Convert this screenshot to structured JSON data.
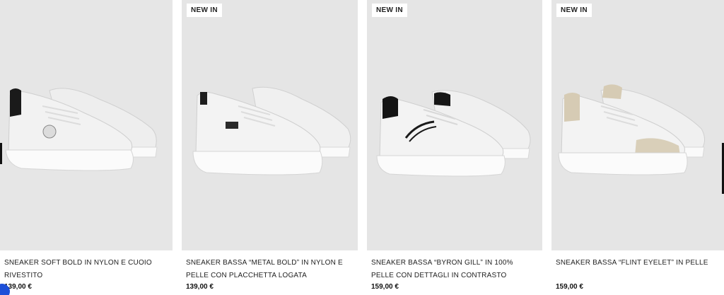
{
  "products": [
    {
      "badge": "",
      "name": "SNEAKER SOFT BOLD IN NYLON E CUOIO RIVESTITO",
      "price": "139,00 €",
      "accent": "#1a1a1a"
    },
    {
      "badge": "NEW IN",
      "name": "SNEAKER BASSA “METAL BOLD” IN NYLON E PELLE CON PLACCHETTA LOGATA",
      "price": "139,00 €",
      "accent": "#2a2a2a"
    },
    {
      "badge": "NEW IN",
      "name": "SNEAKER BASSA “BYRON GILL” IN 100% PELLE CON DETTAGLI IN CONTRASTO",
      "price": "159,00 €",
      "accent": "#111111"
    },
    {
      "badge": "NEW IN",
      "name": "SNEAKER BASSA “FLINT EYELET” IN PELLE",
      "price": "159,00 €",
      "accent": "#d6cbb4"
    }
  ],
  "colors": {
    "image_bg": "#e5e5e5",
    "shoe_white": "#f4f4f4",
    "sole": "#ffffff",
    "loader_blue": "#1d4fd8"
  }
}
